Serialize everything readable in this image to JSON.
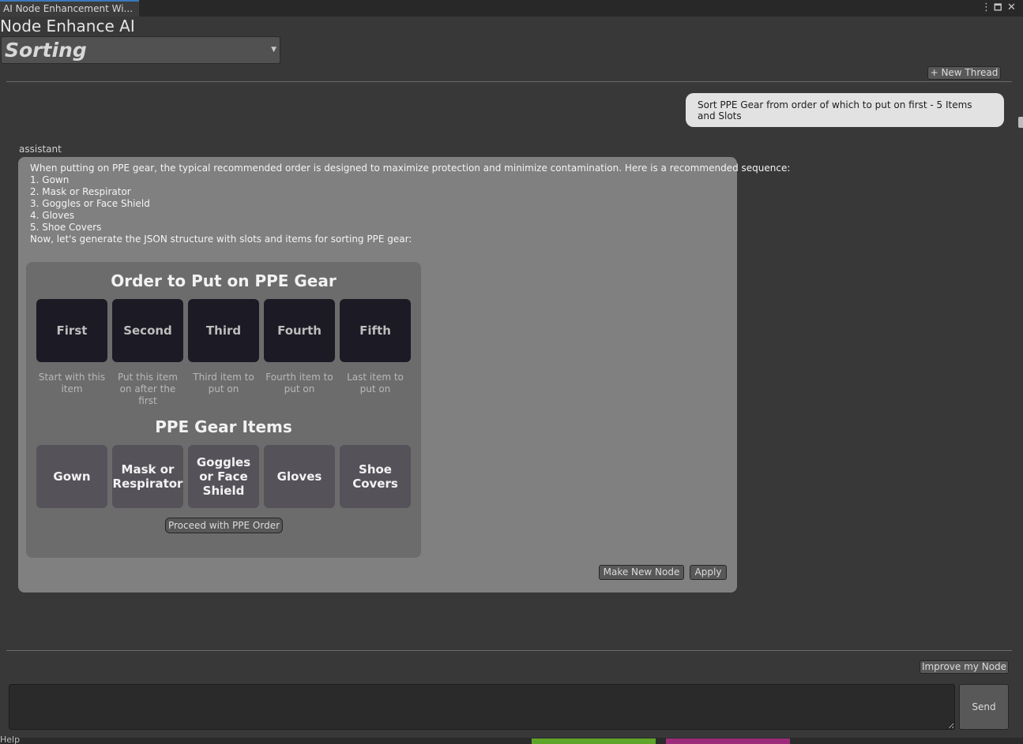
{
  "window": {
    "tab_title": "AI Node Enhancement Wi...",
    "menu_glyph": "⋮",
    "maximize_glyph": "🗖",
    "close_glyph": "✕"
  },
  "header": {
    "app_title": "Node Enhance AI",
    "mode_dropdown": {
      "selected": "Sorting",
      "arrow": "▼"
    }
  },
  "toolbar": {
    "new_thread_label": "+ New Thread"
  },
  "conversation": {
    "user_message": "Sort PPE Gear from order of which to put on first - 5 Items and Slots",
    "assistant_role": "assistant",
    "assistant_lines": [
      "When putting on PPE gear, the typical recommended order is designed to maximize protection and minimize contamination. Here is a recommended sequence:",
      "1. Gown",
      "2. Mask or Respirator",
      "3. Goggles or Face Shield",
      "4. Gloves",
      "5. Shoe Covers",
      "Now, let's generate the JSON structure with slots and items for sorting PPE gear:"
    ]
  },
  "preview": {
    "slots_title": "Order to Put on PPE Gear",
    "slots": [
      {
        "label": "First",
        "description": "Start with this item"
      },
      {
        "label": "Second",
        "description": "Put this item on after the first"
      },
      {
        "label": "Third",
        "description": "Third item to put on"
      },
      {
        "label": "Fourth",
        "description": "Fourth item to put on"
      },
      {
        "label": "Fifth",
        "description": "Last item to put on"
      }
    ],
    "items_title": "PPE Gear Items",
    "items": [
      "Gown",
      "Mask or Respirator",
      "Goggles or Face Shield",
      "Gloves",
      "Shoe Covers"
    ],
    "proceed_label": "Proceed with PPE Order"
  },
  "actions": {
    "make_new_node_label": "Make New Node",
    "apply_label": "Apply",
    "improve_label": "Improve my Node",
    "send_label": "Send"
  },
  "footer": {
    "help_text": "Help"
  },
  "colors": {
    "background": "#383838",
    "assistant_panel": "#808080",
    "slot_dark": "#1c1a24",
    "item_tile": "#56525a",
    "user_bubble": "#e2e2e2",
    "strip_green": "#5fa52a",
    "strip_magenta": "#9c2c7a"
  }
}
